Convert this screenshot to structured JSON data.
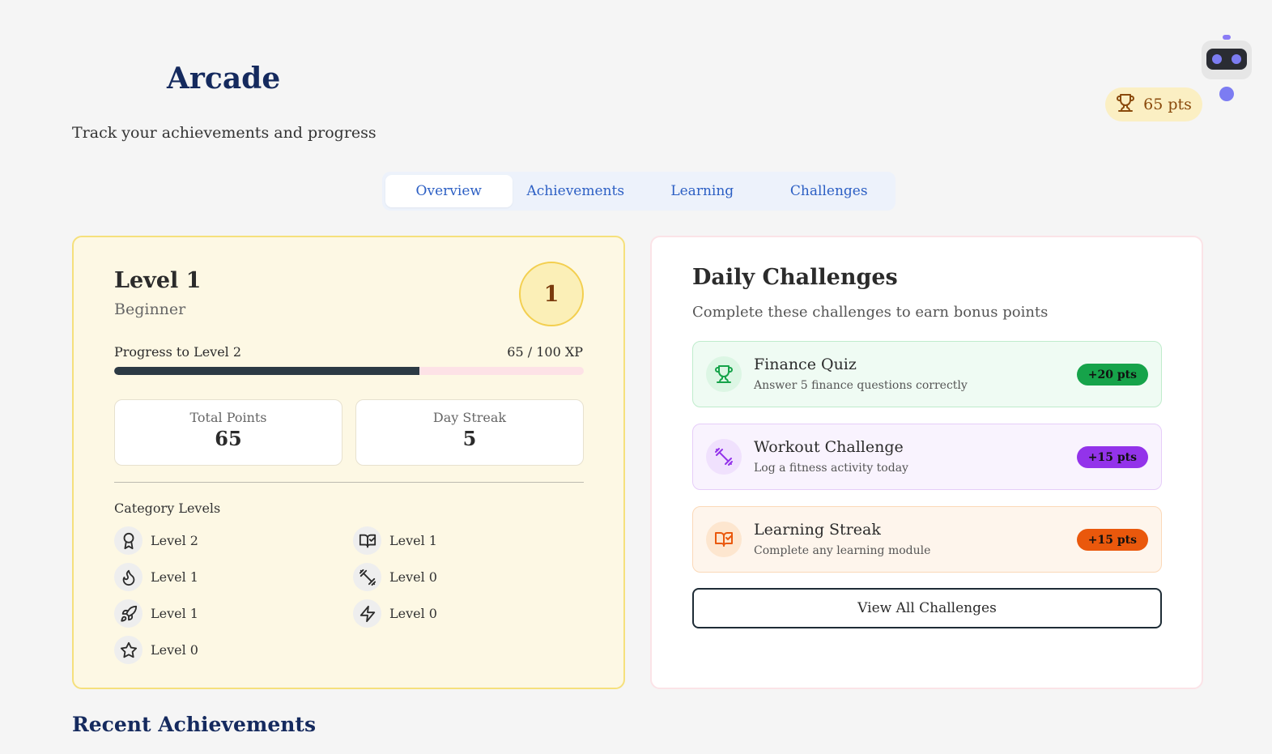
{
  "header": {
    "title": "Arcade",
    "subtitle": "Track your achievements and progress",
    "points": "65 pts"
  },
  "tabs": [
    {
      "label": "Overview",
      "active": true
    },
    {
      "label": "Achievements",
      "active": false
    },
    {
      "label": "Learning",
      "active": false
    },
    {
      "label": "Challenges",
      "active": false
    }
  ],
  "level_card": {
    "title": "Level 1",
    "rank": "Beginner",
    "badge": "1",
    "progress_label": "Progress to Level 2",
    "progress_value": "65 / 100 XP",
    "progress_fraction": 0.65,
    "stats": [
      {
        "label": "Total Points",
        "value": "65"
      },
      {
        "label": "Day Streak",
        "value": "5"
      }
    ],
    "category_heading": "Category Levels",
    "categories": [
      {
        "icon": "award-icon",
        "label": "Level 2"
      },
      {
        "icon": "book-check-icon",
        "label": "Level 1"
      },
      {
        "icon": "flame-icon",
        "label": "Level 1"
      },
      {
        "icon": "dumbbell-icon",
        "label": "Level 0"
      },
      {
        "icon": "rocket-icon",
        "label": "Level 1"
      },
      {
        "icon": "zap-icon",
        "label": "Level 0"
      },
      {
        "icon": "star-icon",
        "label": "Level 0"
      }
    ]
  },
  "challenges": {
    "title": "Daily Challenges",
    "subtitle": "Complete these challenges to earn bonus points",
    "items": [
      {
        "icon": "trophy-icon",
        "name": "Finance Quiz",
        "desc": "Answer 5 finance questions correctly",
        "points": "+20 pts",
        "color": "#16a34a",
        "bg": "#effbf3",
        "border": "#bfeccc",
        "icon_bg": "#dcf6e4"
      },
      {
        "icon": "dumbbell-icon",
        "name": "Workout Challenge",
        "desc": "Log a fitness activity today",
        "points": "+15 pts",
        "color": "#9333ea",
        "bg": "#f9f3fe",
        "border": "#e6cdf9",
        "icon_bg": "#f0e1fd"
      },
      {
        "icon": "book-check-icon",
        "name": "Learning Streak",
        "desc": "Complete any learning module",
        "points": "+15 pts",
        "color": "#ea580c",
        "bg": "#fef5ec",
        "border": "#fbd9b8",
        "icon_bg": "#fde6cf"
      }
    ],
    "view_all": "View All Challenges"
  },
  "recent": {
    "heading": "Recent Achievements"
  }
}
